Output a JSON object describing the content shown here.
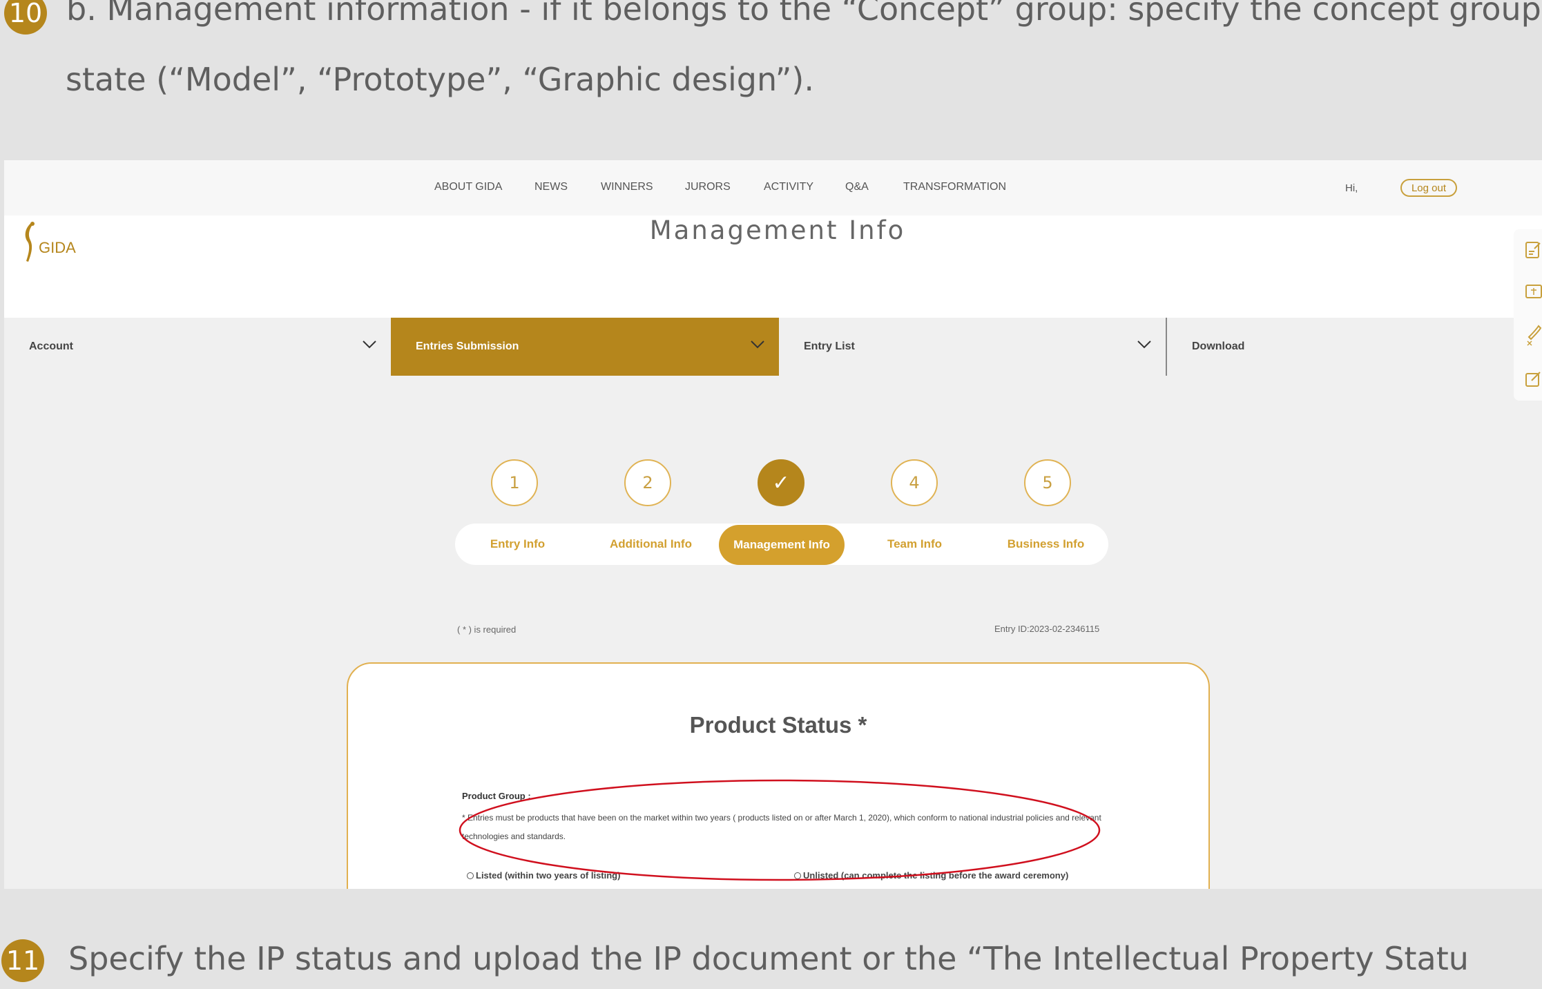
{
  "instructions": {
    "step10": {
      "num": "10",
      "line1": "b. Management information - if it belongs to the “Concept” group: specify the concept group",
      "line2": "state (“Model”, “Prototype”, “Graphic design”)."
    },
    "step11": {
      "num": "11",
      "text": "Specify the IP status and upload the IP document or the “The Intellectual Property Statu"
    }
  },
  "nav": {
    "items": [
      "ABOUT GIDA",
      "NEWS",
      "WINNERS",
      "JURORS",
      "ACTIVITY",
      "Q&A",
      "TRANSFORMATION"
    ],
    "greeting": "Hi,",
    "logout": "Log out"
  },
  "header": {
    "logo": "GIDA",
    "title": "Management Info"
  },
  "menu": {
    "account": "Account",
    "entries": "Entries Submission",
    "entry_list": "Entry List",
    "download": "Download"
  },
  "side_tools": [
    "edit-doc-icon",
    "id-card-icon",
    "phone-icon",
    "write-icon"
  ],
  "steps": {
    "circles": [
      "1",
      "2",
      "✓",
      "4",
      "5"
    ],
    "tabs": [
      "Entry Info",
      "Additional Info",
      "Management Info",
      "Team Info",
      "Business Info"
    ],
    "active_index": 2
  },
  "form": {
    "required_note": "( * ) is required",
    "entry_id": "Entry ID:2023-02-2346115",
    "card_title": "Product Status *",
    "product_group_label": "Product Group :",
    "product_group_note": "* Entries must be products that have been on the market within two years ( products listed on or after March 1, 2020), which conform to national industrial policies and relevant technologies and standards.",
    "option_listed": "Listed (within two years of listing)",
    "option_unlisted": "Unlisted (can complete the listing before the award ceremony)"
  },
  "colors": {
    "accent": "#b5861c",
    "highlight_ellipse": "#d0101e"
  }
}
